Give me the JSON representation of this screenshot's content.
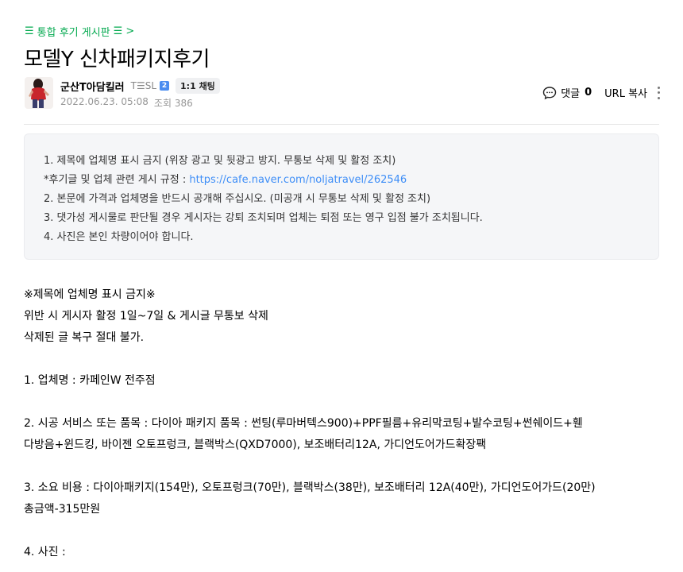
{
  "board": {
    "label": "통합 후기 게시판"
  },
  "article": {
    "title": "모델Y 신차패키지후기"
  },
  "author": {
    "nickname": "군산T아담킬러",
    "grade": "T☰SL",
    "level": "2",
    "chat_label": "1:1 채팅",
    "date": "2022.06.23. 05:08",
    "views_label": "조회 386"
  },
  "tools": {
    "comment_label": "댓글",
    "comment_count": "0",
    "url_copy": "URL 복사"
  },
  "notice": {
    "line1": "1. 제목에 업체명 표시 금지 (위장 광고 및 뒷광고 방지. 무통보 삭제 및 활정 조치)",
    "line2_prefix": "*후기글 및 업체 관련 게시 규정 : ",
    "line2_link": "https://cafe.naver.com/noljatravel/262546",
    "line3": "2. 본문에 가격과 업체명을 반드시 공개해 주십시오. (미공개 시 무통보 삭제 및 활정 조치)",
    "line4": "3. 댓가성 게시물로 판단될 경우 게시자는 강퇴 조치되며 업체는 퇴점 또는 영구 입점 불가 조치됩니다.",
    "line5": "4. 사진은 본인 차량이어야 합니다."
  },
  "content": {
    "l1": "※제목에 업체명 표시 금지※",
    "l2": "위반 시 게시자 활정 1일~7일 & 게시글 무통보 삭제",
    "l3": "삭제된 글 복구 절대 불가.",
    "l4": "1. 업체명 :  카페인W 전주점",
    "l5": "2. 시공 서비스 또는 품목 :  다이아 패키지 품목 : 썬팅(루마버텍스900)+PPF필름+유리막코팅+발수코팅+썬쉐이드+휀",
    "l6": "다방음+윈드킹, 바이젠 오토프렁크, 블랙박스(QXD7000), 보조배터리12A, 가디언도어가드확장팩",
    "l7": "3. 소요 비용 :  다이아패키지(154만), 오토프렁크(70만), 블랙박스(38만), 보조배터리 12A(40만), 가디언도어가드(20만)",
    "l8": "총금액-315만원",
    "l9": "4. 사진 :"
  },
  "colors": {
    "accent": "#03a94f",
    "link": "#3e8ef7",
    "level_badge": "#4a8cf0"
  }
}
